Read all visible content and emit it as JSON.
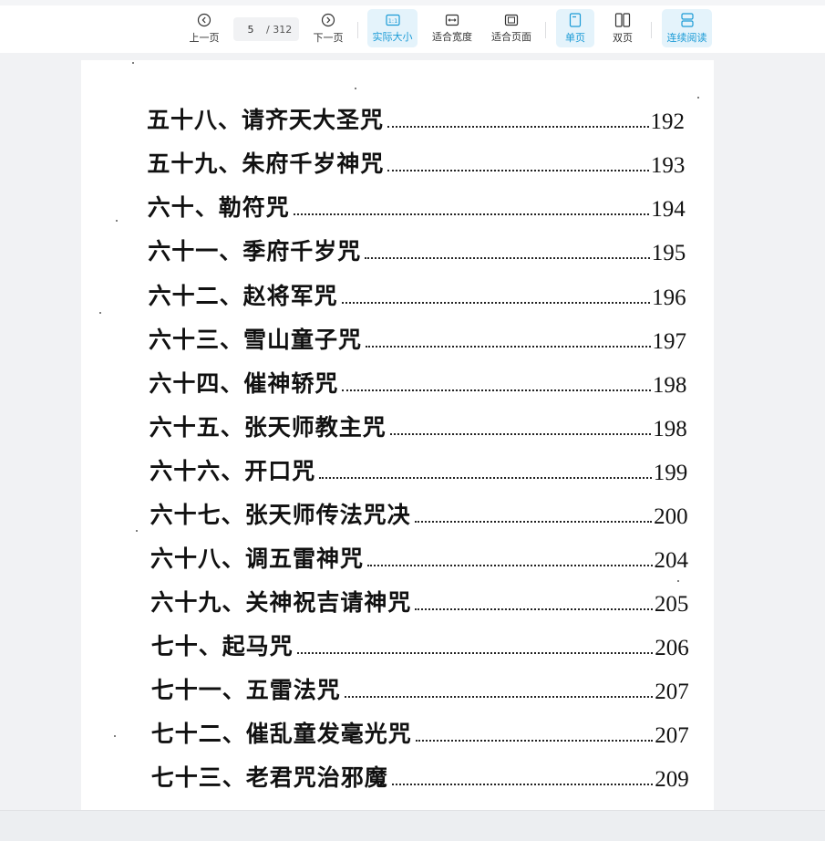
{
  "toolbar": {
    "prev_label": "上一页",
    "next_label": "下一页",
    "current_page": "5",
    "total_pages": "/ 312",
    "actual_size_label": "实际大小",
    "fit_width_label": "适合宽度",
    "fit_page_label": "适合页面",
    "single_page_label": "单页",
    "double_page_label": "双页",
    "continuous_label": "连续阅读",
    "accent_color": "#1b9bd6"
  },
  "document": {
    "toc": [
      {
        "title": "五十八、请齐天大圣咒",
        "page": "192"
      },
      {
        "title": "五十九、朱府千岁神咒",
        "page": "193"
      },
      {
        "title": "六十、勒符咒",
        "page": "194"
      },
      {
        "title": "六十一、季府千岁咒",
        "page": "195"
      },
      {
        "title": "六十二、赵将军咒",
        "page": "196"
      },
      {
        "title": "六十三、雪山童子咒",
        "page": "197"
      },
      {
        "title": "六十四、催神轿咒",
        "page": "198"
      },
      {
        "title": "六十五、张天师教主咒",
        "page": "198"
      },
      {
        "title": "六十六、开口咒",
        "page": "199"
      },
      {
        "title": "六十七、张天师传法咒决",
        "page": "200"
      },
      {
        "title": "六十八、调五雷神咒",
        "page": "204"
      },
      {
        "title": "六十九、关神祝吉请神咒",
        "page": "205"
      },
      {
        "title": "七十、起马咒",
        "page": "206"
      },
      {
        "title": "七十一、五雷法咒",
        "page": "207"
      },
      {
        "title": "七十二、催乱童发毫光咒",
        "page": "207"
      },
      {
        "title": "七十三、老君咒治邪魔",
        "page": "209"
      }
    ]
  }
}
